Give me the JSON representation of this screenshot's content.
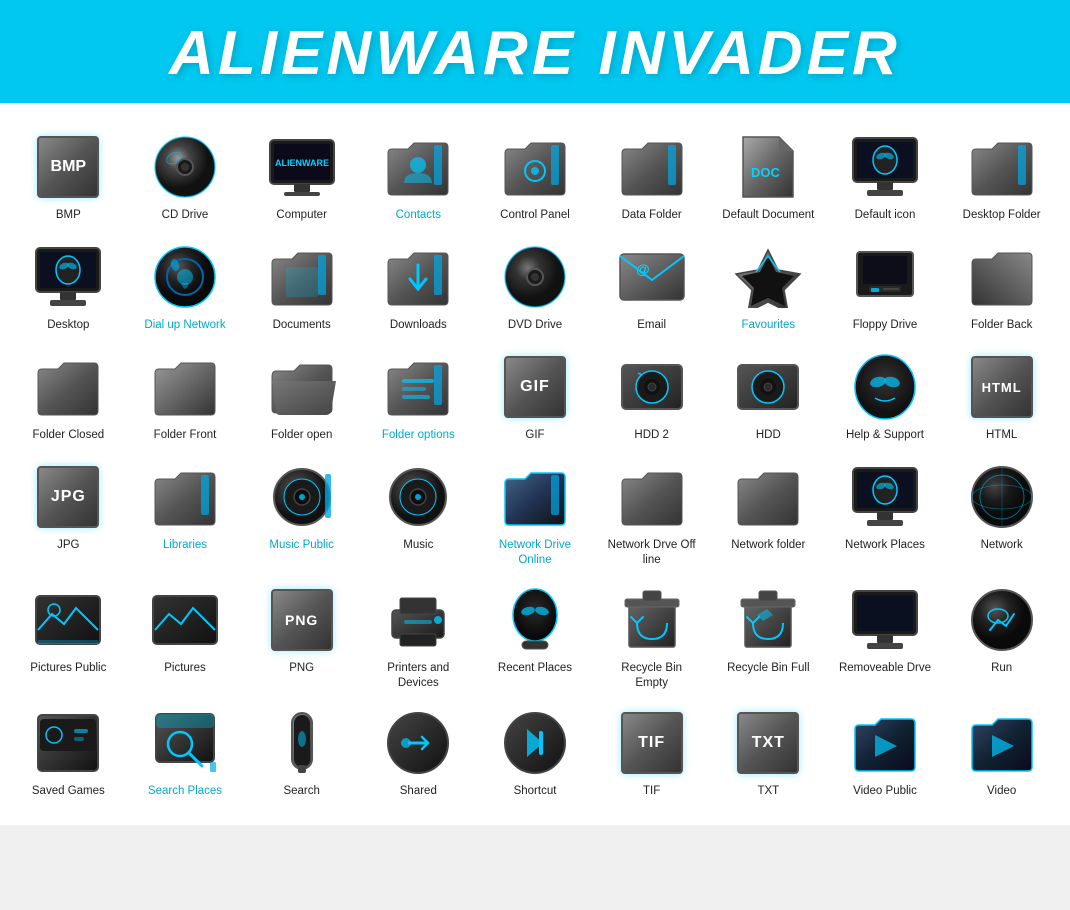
{
  "header": {
    "title": "ALIENWARE INVADER"
  },
  "icons": [
    {
      "id": "bmp",
      "label": "BMP",
      "labelColor": "normal",
      "shape": "text-badge",
      "text": "BMP"
    },
    {
      "id": "cd-drive",
      "label": "CD Drive",
      "labelColor": "normal",
      "shape": "disc"
    },
    {
      "id": "computer",
      "label": "Computer",
      "labelColor": "normal",
      "shape": "monitor-alienware"
    },
    {
      "id": "contacts",
      "label": "Contacts",
      "labelColor": "cyan",
      "shape": "folder-contacts"
    },
    {
      "id": "control-panel",
      "label": "Control Panel",
      "labelColor": "normal",
      "shape": "folder-control"
    },
    {
      "id": "data-folder",
      "label": "Data Folder",
      "labelColor": "normal",
      "shape": "folder-data"
    },
    {
      "id": "default-document",
      "label": "Default Document",
      "labelColor": "normal",
      "shape": "doc-default"
    },
    {
      "id": "default-icon",
      "label": "Default icon",
      "labelColor": "normal",
      "shape": "monitor-alien"
    },
    {
      "id": "desktop-folder",
      "label": "Desktop Folder",
      "labelColor": "normal",
      "shape": "folder-desktop"
    },
    {
      "id": "desktop",
      "label": "Desktop",
      "labelColor": "normal",
      "shape": "monitor-desktop"
    },
    {
      "id": "dial-up-network",
      "label": "Dial up Network",
      "labelColor": "cyan",
      "shape": "sphere-dial"
    },
    {
      "id": "documents",
      "label": "Documents",
      "labelColor": "normal",
      "shape": "folder-documents"
    },
    {
      "id": "downloads",
      "label": "Downloads",
      "labelColor": "normal",
      "shape": "folder-downloads"
    },
    {
      "id": "dvd-drive",
      "label": "DVD Drive",
      "labelColor": "normal",
      "shape": "disc-dvd"
    },
    {
      "id": "email",
      "label": "Email",
      "labelColor": "normal",
      "shape": "email"
    },
    {
      "id": "favourites",
      "label": "Favourites",
      "labelColor": "cyan",
      "shape": "favourites"
    },
    {
      "id": "floppy-drive",
      "label": "Floppy Drive",
      "labelColor": "normal",
      "shape": "monitor-floppy"
    },
    {
      "id": "folder-back",
      "label": "Folder Back",
      "labelColor": "normal",
      "shape": "folder-back"
    },
    {
      "id": "folder-closed",
      "label": "Folder Closed",
      "labelColor": "normal",
      "shape": "folder-closed"
    },
    {
      "id": "folder-front",
      "label": "Folder Front",
      "labelColor": "normal",
      "shape": "folder-front"
    },
    {
      "id": "folder-open",
      "label": "Folder open",
      "labelColor": "normal",
      "shape": "folder-open"
    },
    {
      "id": "folder-options",
      "label": "Folder options",
      "labelColor": "cyan",
      "shape": "folder-options"
    },
    {
      "id": "gif",
      "label": "GIF",
      "labelColor": "normal",
      "shape": "text-badge-gif"
    },
    {
      "id": "hdd2",
      "label": "HDD 2",
      "labelColor": "normal",
      "shape": "hdd2"
    },
    {
      "id": "hdd",
      "label": "HDD",
      "labelColor": "normal",
      "shape": "hdd"
    },
    {
      "id": "help-support",
      "label": "Help & Support",
      "labelColor": "normal",
      "shape": "alien-head"
    },
    {
      "id": "html",
      "label": "HTML",
      "labelColor": "normal",
      "shape": "text-badge-html"
    },
    {
      "id": "jpg",
      "label": "JPG",
      "labelColor": "normal",
      "shape": "text-badge-jpg"
    },
    {
      "id": "libraries",
      "label": "Libraries",
      "labelColor": "cyan",
      "shape": "folder-libraries"
    },
    {
      "id": "music-public",
      "label": "Music Public",
      "labelColor": "cyan",
      "shape": "speaker-public"
    },
    {
      "id": "music",
      "label": "Music",
      "labelColor": "normal",
      "shape": "speaker"
    },
    {
      "id": "network-drive-online",
      "label": "Network Drive Online",
      "labelColor": "cyan",
      "shape": "folder-net-online"
    },
    {
      "id": "network-drive-offline",
      "label": "Network Drve Off line",
      "labelColor": "normal",
      "shape": "folder-net-offline"
    },
    {
      "id": "network-folder",
      "label": "Network folder",
      "labelColor": "normal",
      "shape": "folder-network"
    },
    {
      "id": "network-places",
      "label": "Network Places",
      "labelColor": "normal",
      "shape": "monitor-network"
    },
    {
      "id": "network",
      "label": "Network",
      "labelColor": "normal",
      "shape": "sphere-network"
    },
    {
      "id": "pictures-public",
      "label": "Pictures Public",
      "labelColor": "normal",
      "shape": "pictures-public"
    },
    {
      "id": "pictures",
      "label": "Pictures",
      "labelColor": "normal",
      "shape": "pictures"
    },
    {
      "id": "png",
      "label": "PNG",
      "labelColor": "normal",
      "shape": "text-badge-png"
    },
    {
      "id": "printers-devices",
      "label": "Printers and Devices",
      "labelColor": "normal",
      "shape": "printer"
    },
    {
      "id": "recent-places",
      "label": "Recent Places",
      "labelColor": "normal",
      "shape": "alien-stand"
    },
    {
      "id": "recycle-bin-empty",
      "label": "Recycle Bin Empty",
      "labelColor": "normal",
      "shape": "recycle-empty"
    },
    {
      "id": "recycle-bin-full",
      "label": "Recycle Bin Full",
      "labelColor": "normal",
      "shape": "recycle-full"
    },
    {
      "id": "removeable-drive",
      "label": "Removeable Drve",
      "labelColor": "normal",
      "shape": "monitor-remove"
    },
    {
      "id": "run",
      "label": "Run",
      "labelColor": "normal",
      "shape": "sphere-run"
    },
    {
      "id": "saved-games",
      "label": "Saved Games",
      "labelColor": "normal",
      "shape": "saved-games"
    },
    {
      "id": "search-places",
      "label": "Search Places",
      "labelColor": "cyan",
      "shape": "search-places"
    },
    {
      "id": "search",
      "label": "Search",
      "labelColor": "normal",
      "shape": "search"
    },
    {
      "id": "shared",
      "label": "Shared",
      "labelColor": "normal",
      "shape": "shared"
    },
    {
      "id": "shortcut",
      "label": "Shortcut",
      "labelColor": "normal",
      "shape": "shortcut"
    },
    {
      "id": "tif",
      "label": "TIF",
      "labelColor": "normal",
      "shape": "text-badge-tif"
    },
    {
      "id": "txt",
      "label": "TXT",
      "labelColor": "normal",
      "shape": "text-badge-txt"
    },
    {
      "id": "video-public",
      "label": "Video Public",
      "labelColor": "normal",
      "shape": "video-public"
    },
    {
      "id": "video",
      "label": "Video",
      "labelColor": "normal",
      "shape": "video"
    }
  ]
}
